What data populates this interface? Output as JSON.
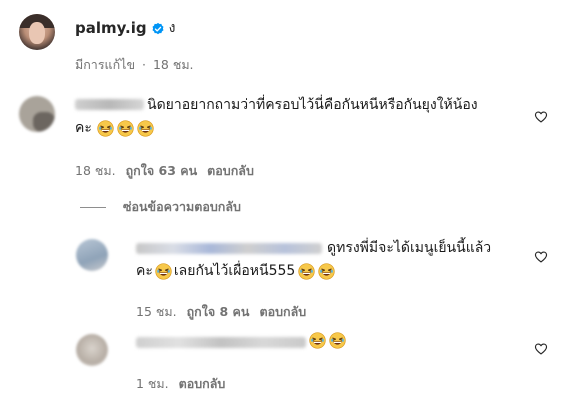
{
  "post": {
    "username": "palmy.ig",
    "caption_suffix": "ง",
    "edited_label": "มีการแก้ไข",
    "separator": "·",
    "time": "18 ชม."
  },
  "comment1": {
    "text_line1": "นิดยาอยากถามว่าที่ครอบไว้นี่คือกันหนีหรือกันยุงให้น้อง",
    "text_line2": "คะ",
    "time": "18 ชม.",
    "likes": "ถูกใจ 63 คน",
    "reply_label": "ตอบกลับ",
    "hide_replies": "ซ่อนข้อความตอบกลับ"
  },
  "reply1": {
    "text_line1": "ดูทรงพี่มีจะได้เมนูเย็นนี้แล้ว",
    "text_line2_prefix": "คะ",
    "text_line2_suffix": "เลยกันไว้เผื่อหนี555",
    "time": "15 ชม.",
    "likes": "ถูกใจ 8 คน",
    "reply_label": "ตอบกลับ"
  },
  "reply2": {
    "time": "1 ชม.",
    "reply_label": "ตอบกลับ"
  },
  "colors": {
    "verified": "#0095f6",
    "meta_text": "#737373",
    "divider": "#8e8e8e"
  },
  "icons": [
    "verified-badge-icon",
    "grinning-squinting-face-emoji",
    "heart-outline-icon"
  ]
}
